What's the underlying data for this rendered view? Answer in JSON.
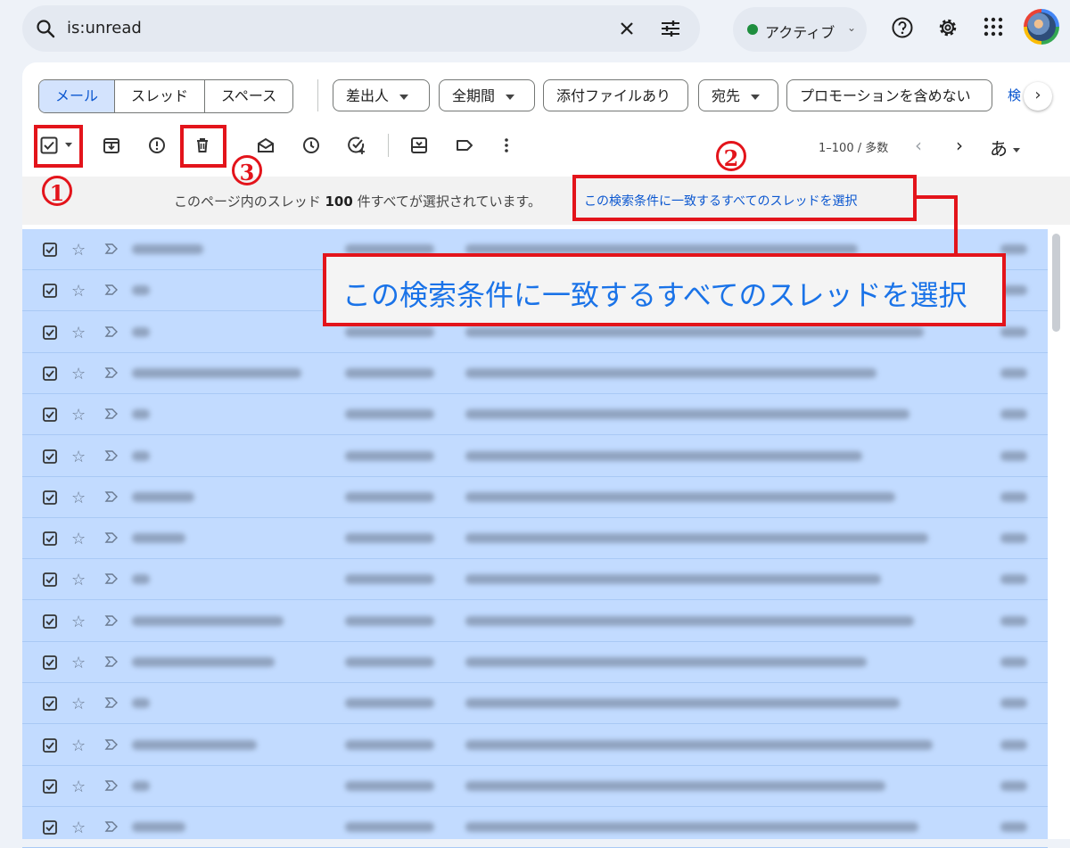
{
  "search": {
    "query": "is:unread"
  },
  "status": {
    "label": "アクティブ"
  },
  "filters": {
    "segments": [
      "メール",
      "スレッド",
      "スペース"
    ],
    "chips": [
      "差出人",
      "全期間",
      "添付ファイルあり",
      "宛先",
      "プロモーションを含めない"
    ],
    "overflow": "検"
  },
  "toolbar": {
    "page_info": "1–100 / 多数",
    "lang": "あ"
  },
  "banner": {
    "text_prefix": "このページ内のスレッド",
    "count": "100",
    "text_suffix": "件すべてが選択されています。",
    "select_all_link": "この検索条件に一致するすべてのスレッドを選択"
  },
  "callout": {
    "text": "この検索条件に一致するすべてのスレッドを選択"
  },
  "annotations": {
    "n1": "1",
    "n2": "2",
    "n3": "3"
  },
  "rows_count_visible": 15,
  "colors": {
    "accent_red": "#e3141b",
    "selected_row": "#c2dbff",
    "link_blue": "#0b57d0"
  }
}
